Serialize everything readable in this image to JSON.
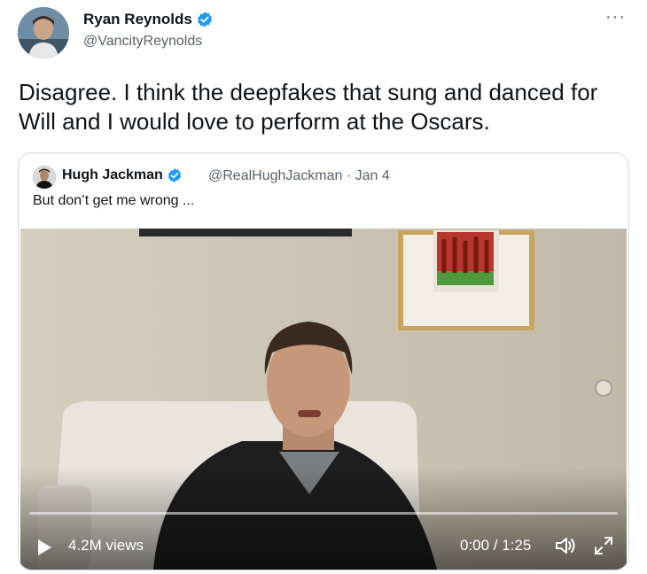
{
  "tweet": {
    "author_name": "Ryan Reynolds",
    "author_handle": "@VancityReynolds",
    "more_label": "···",
    "text": "Disagree. I think the deepfakes that sung and danced for Will and I would love to perform at the Oscars."
  },
  "quoted_tweet": {
    "author_name": "Hugh Jackman",
    "author_handle": "@RealHughJackman",
    "date": "Jan 4",
    "handle_line": "@RealHughJackman · Jan 4",
    "text": "But don’t get me wrong ..."
  },
  "video": {
    "views": "4.2M views",
    "time": "0:00 / 1:25",
    "progress": 0
  },
  "icons": {
    "verified": "verified-badge-icon",
    "play": "play-icon",
    "volume": "volume-icon",
    "fullscreen": "fullscreen-icon"
  },
  "colors": {
    "verified": "#1d9bf0",
    "secondary_text": "#536471",
    "border": "#cfd9de"
  }
}
